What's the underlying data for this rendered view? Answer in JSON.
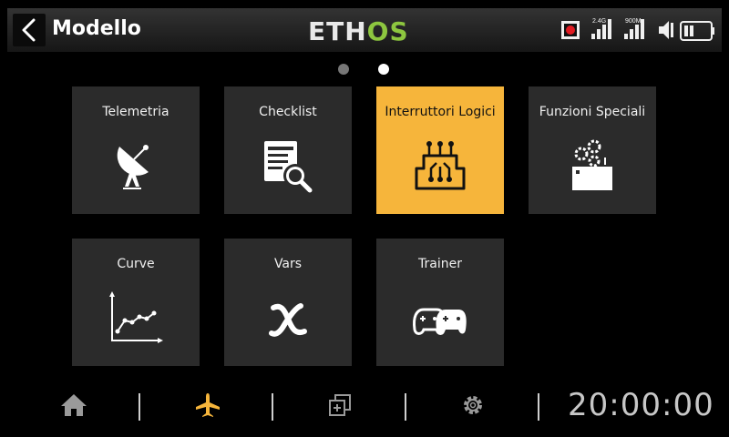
{
  "header": {
    "back_icon": "chevron-left-icon",
    "title": "Modello",
    "logo_main": "ETH",
    "logo_accent": "OS",
    "logo_accent_color": "#8dc63f",
    "status": {
      "record_color": "#e11b22",
      "signal_2g_label": "2.4G",
      "signal_900_label": "900M",
      "mute_icon": "speaker-muted-icon",
      "battery_icon": "battery-icon"
    }
  },
  "page_dots": {
    "count": 2,
    "active": 1
  },
  "tiles": [
    {
      "label": "Telemetria",
      "icon": "satellite-dish-icon",
      "active": false
    },
    {
      "label": "Checklist",
      "icon": "checklist-search-icon",
      "active": false
    },
    {
      "label": "Interruttori Logici",
      "icon": "logic-circuit-icon",
      "active": true
    },
    {
      "label": "Funzioni Speciali",
      "icon": "gears-panel-icon",
      "active": false
    },
    {
      "label": "Curve",
      "icon": "curve-graph-icon",
      "active": false
    },
    {
      "label": "Vars",
      "icon": "variable-x-icon",
      "active": false
    },
    {
      "label": "Trainer",
      "icon": "gamepads-icon",
      "active": false
    }
  ],
  "accent_color": "#f6b53b",
  "bottom_nav": {
    "items": [
      {
        "icon": "home-icon",
        "active": false
      },
      {
        "icon": "airplane-icon",
        "active": true
      },
      {
        "icon": "screens-icon",
        "active": false
      },
      {
        "icon": "gear-icon",
        "active": false
      }
    ],
    "clock": "20:00:00"
  }
}
